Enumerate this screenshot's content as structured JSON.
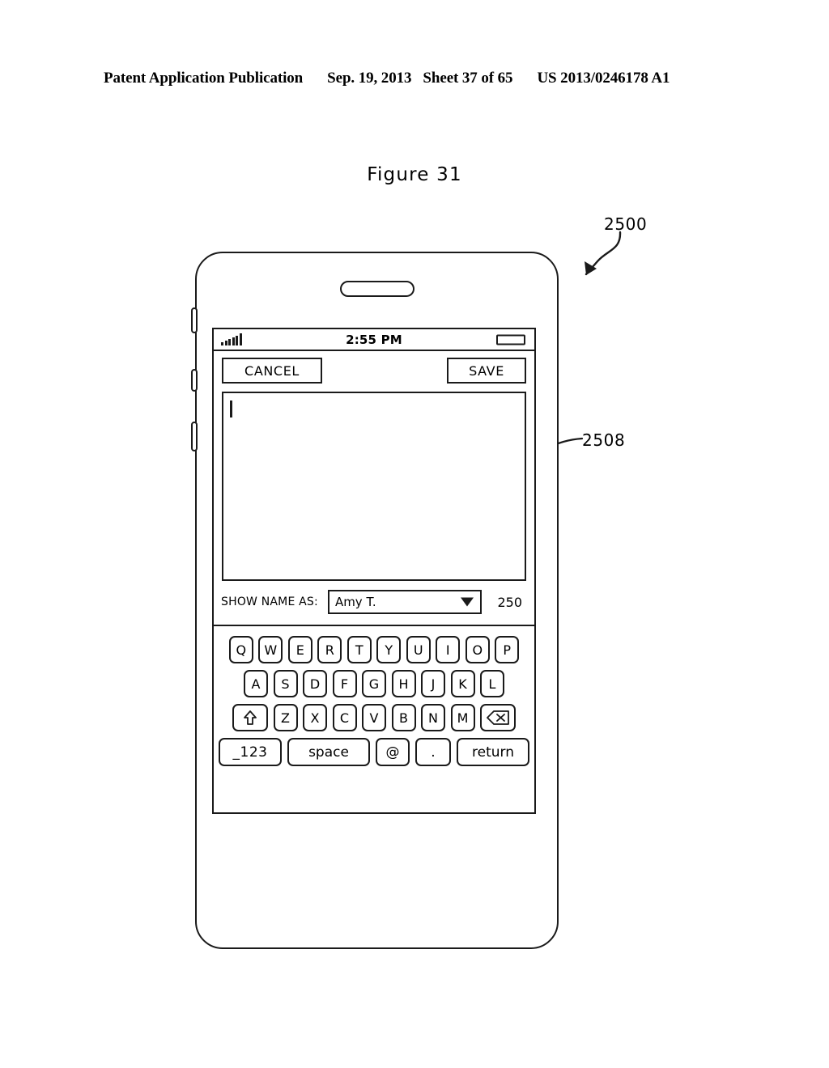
{
  "header": {
    "publication": "Patent Application Publication",
    "date": "Sep. 19, 2013",
    "sheet": "Sheet 37 of 65",
    "patent_number": "US 2013/0246178 A1"
  },
  "figure": {
    "title": "Figure 31",
    "callouts": {
      "device": "2500",
      "text_area": "2508"
    }
  },
  "device": {
    "status_bar": {
      "signal_icon": "signal-bars-icon",
      "time": "2:55 PM",
      "battery_icon": "battery-icon"
    },
    "toolbar": {
      "cancel_label": "CANCEL",
      "save_label": "SAVE"
    },
    "text_area": {
      "value": "",
      "caret_visible": true
    },
    "name_row": {
      "label": "SHOW NAME AS:",
      "selected_value": "Amy T.",
      "dropdown_icon": "chevron-down-icon",
      "char_count": "250"
    },
    "keyboard": {
      "row1": [
        "Q",
        "W",
        "E",
        "R",
        "T",
        "Y",
        "U",
        "I",
        "O",
        "P"
      ],
      "row2": [
        "A",
        "S",
        "D",
        "F",
        "G",
        "H",
        "J",
        "K",
        "L"
      ],
      "row3_letters": [
        "Z",
        "X",
        "C",
        "V",
        "B",
        "N",
        "M"
      ],
      "shift_icon": "shift-arrow-icon",
      "backspace_icon": "backspace-icon",
      "numeric_label": "_123",
      "space_label": "space",
      "at_label": "@",
      "period_label": ".",
      "return_label": "return"
    }
  },
  "colors": {
    "ink": "#1a1a1a",
    "paper": "#ffffff"
  }
}
